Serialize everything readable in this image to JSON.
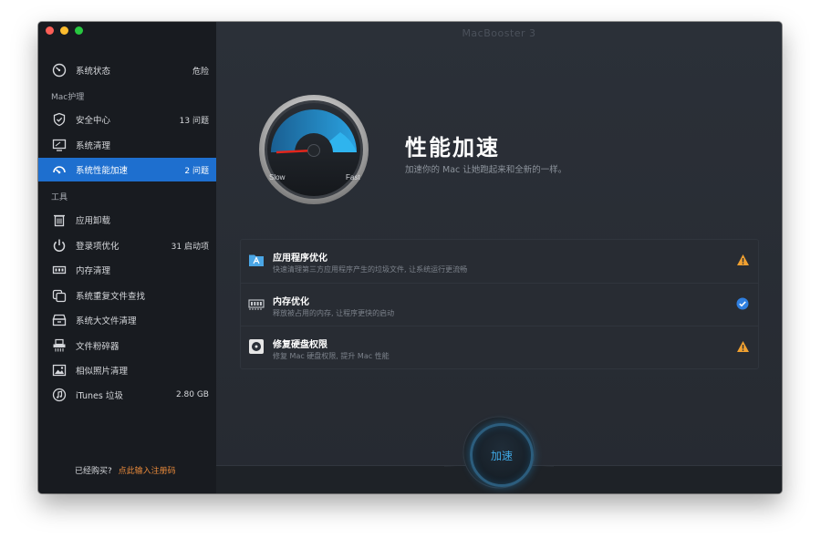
{
  "window": {
    "title": "MacBooster 3"
  },
  "sidebar": {
    "status_item": {
      "label": "系统状态",
      "count": "危险",
      "icon": "speedometer-icon"
    },
    "section_mac": "Mac护理",
    "mac_items": [
      {
        "label": "安全中心",
        "count": "13 问题",
        "icon": "shield-icon"
      },
      {
        "label": "系统清理",
        "count": "",
        "icon": "monitor-icon"
      },
      {
        "label": "系统性能加速",
        "count": "2 问题",
        "icon": "gauge-icon",
        "active": true
      }
    ],
    "section_tools": "工具",
    "tool_items": [
      {
        "label": "应用卸载",
        "count": "",
        "icon": "trash-icon"
      },
      {
        "label": "登录项优化",
        "count": "31 启动项",
        "icon": "power-icon"
      },
      {
        "label": "内存清理",
        "count": "",
        "icon": "ram-icon"
      },
      {
        "label": "系统重复文件查找",
        "count": "",
        "icon": "duplicate-files-icon"
      },
      {
        "label": "系统大文件清理",
        "count": "",
        "icon": "archive-box-icon"
      },
      {
        "label": "文件粉碎器",
        "count": "",
        "icon": "shredder-icon"
      },
      {
        "label": "相似照片清理",
        "count": "",
        "icon": "photo-icon"
      },
      {
        "label": "iTunes 垃圾",
        "count": "2.80 GB",
        "icon": "music-note-icon"
      }
    ],
    "footer": {
      "question": "已经购买?",
      "link": "点此输入注册码"
    }
  },
  "main": {
    "gauge": {
      "slow_label": "Slow",
      "fast_label": "Fast"
    },
    "title": "性能加速",
    "subtitle": "加速你的 Mac 让她跑起来和全新的一样。",
    "items": [
      {
        "title": "应用程序优化",
        "desc": "快速清理第三方应用程序产生的垃圾文件, 让系统运行更流畅",
        "icon": "app-folder-icon",
        "status": "warning"
      },
      {
        "title": "内存优化",
        "desc": "释放被占用的内存, 让程序更快的启动",
        "icon": "memory-chip-icon",
        "status": "ok"
      },
      {
        "title": "修复硬盘权限",
        "desc": "修复 Mac 硬盘权限, 提升 Mac 性能",
        "icon": "disk-icon",
        "status": "warning"
      }
    ],
    "boost_button": "加速"
  },
  "colors": {
    "accent": "#1e6fcf",
    "warning": "#f0a030",
    "ok": "#2f7fe0",
    "link": "#e6883a"
  }
}
